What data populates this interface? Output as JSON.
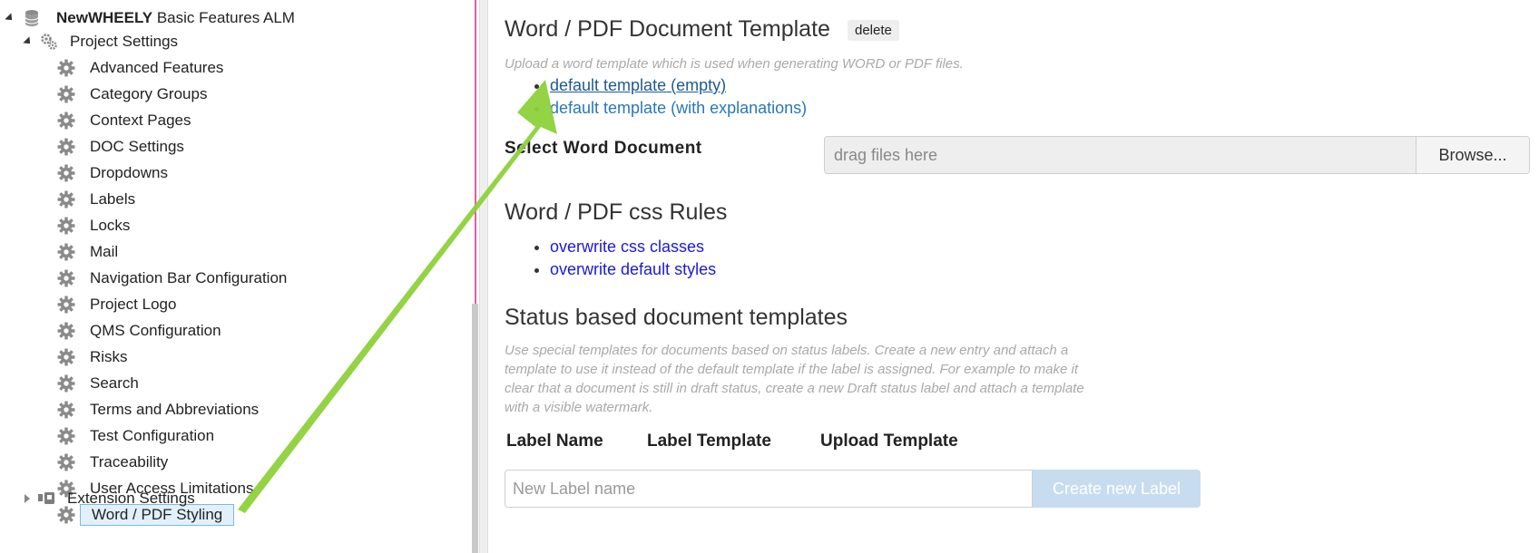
{
  "tree": {
    "root": {
      "name_bold": "NewWHEELY",
      "name_rest": " Basic Features ALM"
    },
    "project_settings": {
      "label": "Project Settings"
    },
    "items": [
      {
        "label": "Advanced Features"
      },
      {
        "label": "Category Groups"
      },
      {
        "label": "Context Pages"
      },
      {
        "label": "DOC Settings"
      },
      {
        "label": "Dropdowns"
      },
      {
        "label": "Labels"
      },
      {
        "label": "Locks"
      },
      {
        "label": "Mail"
      },
      {
        "label": "Navigation Bar Configuration"
      },
      {
        "label": "Project Logo"
      },
      {
        "label": "QMS Configuration"
      },
      {
        "label": "Risks"
      },
      {
        "label": "Search"
      },
      {
        "label": "Terms and Abbreviations"
      },
      {
        "label": "Test Configuration"
      },
      {
        "label": "Traceability"
      },
      {
        "label": "User Access Limitations"
      },
      {
        "label": "Word / PDF Styling",
        "selected": true
      }
    ],
    "extension_settings": {
      "label": "Extension Settings"
    }
  },
  "main": {
    "template_section": {
      "title": "Word / PDF Document Template",
      "delete_label": "delete",
      "hint": "Upload a word template which is used when generating WORD or PDF files.",
      "links": [
        {
          "label": "default template (empty)"
        },
        {
          "label": "default template (with explanations)"
        }
      ],
      "select_label": "Select Word Document",
      "drop_placeholder": "drag files here",
      "browse_label": "Browse..."
    },
    "css_section": {
      "title": "Word / PDF css Rules",
      "links": [
        {
          "label": "overwrite css classes"
        },
        {
          "label": "overwrite default styles"
        }
      ]
    },
    "status_section": {
      "title": "Status based document templates",
      "hint_lines": [
        "Use special templates for documents based on status labels. Create a new entry and attach a",
        "template to use it instead of the default template if the label is assigned. For example to make it",
        "clear that a document is still in draft status, create a new Draft status label and attach a template",
        "with a visible watermark."
      ],
      "columns": [
        "Label Name",
        "Label Template",
        "Upload Template"
      ],
      "input_placeholder": "New Label name",
      "create_label": "Create new Label"
    }
  },
  "colors": {
    "link": "#2a77b7",
    "link_pure": "#1a1ad6",
    "arrow": "#8dd13a",
    "splitter_accent": "#e85aa7",
    "selected_bg": "#e1f0fb",
    "create_btn": "#c7dcef"
  },
  "icons": {
    "root": "database-icon",
    "project_settings": "gears-icon",
    "item": "gear-icon",
    "extension_settings": "plugin-icon"
  }
}
